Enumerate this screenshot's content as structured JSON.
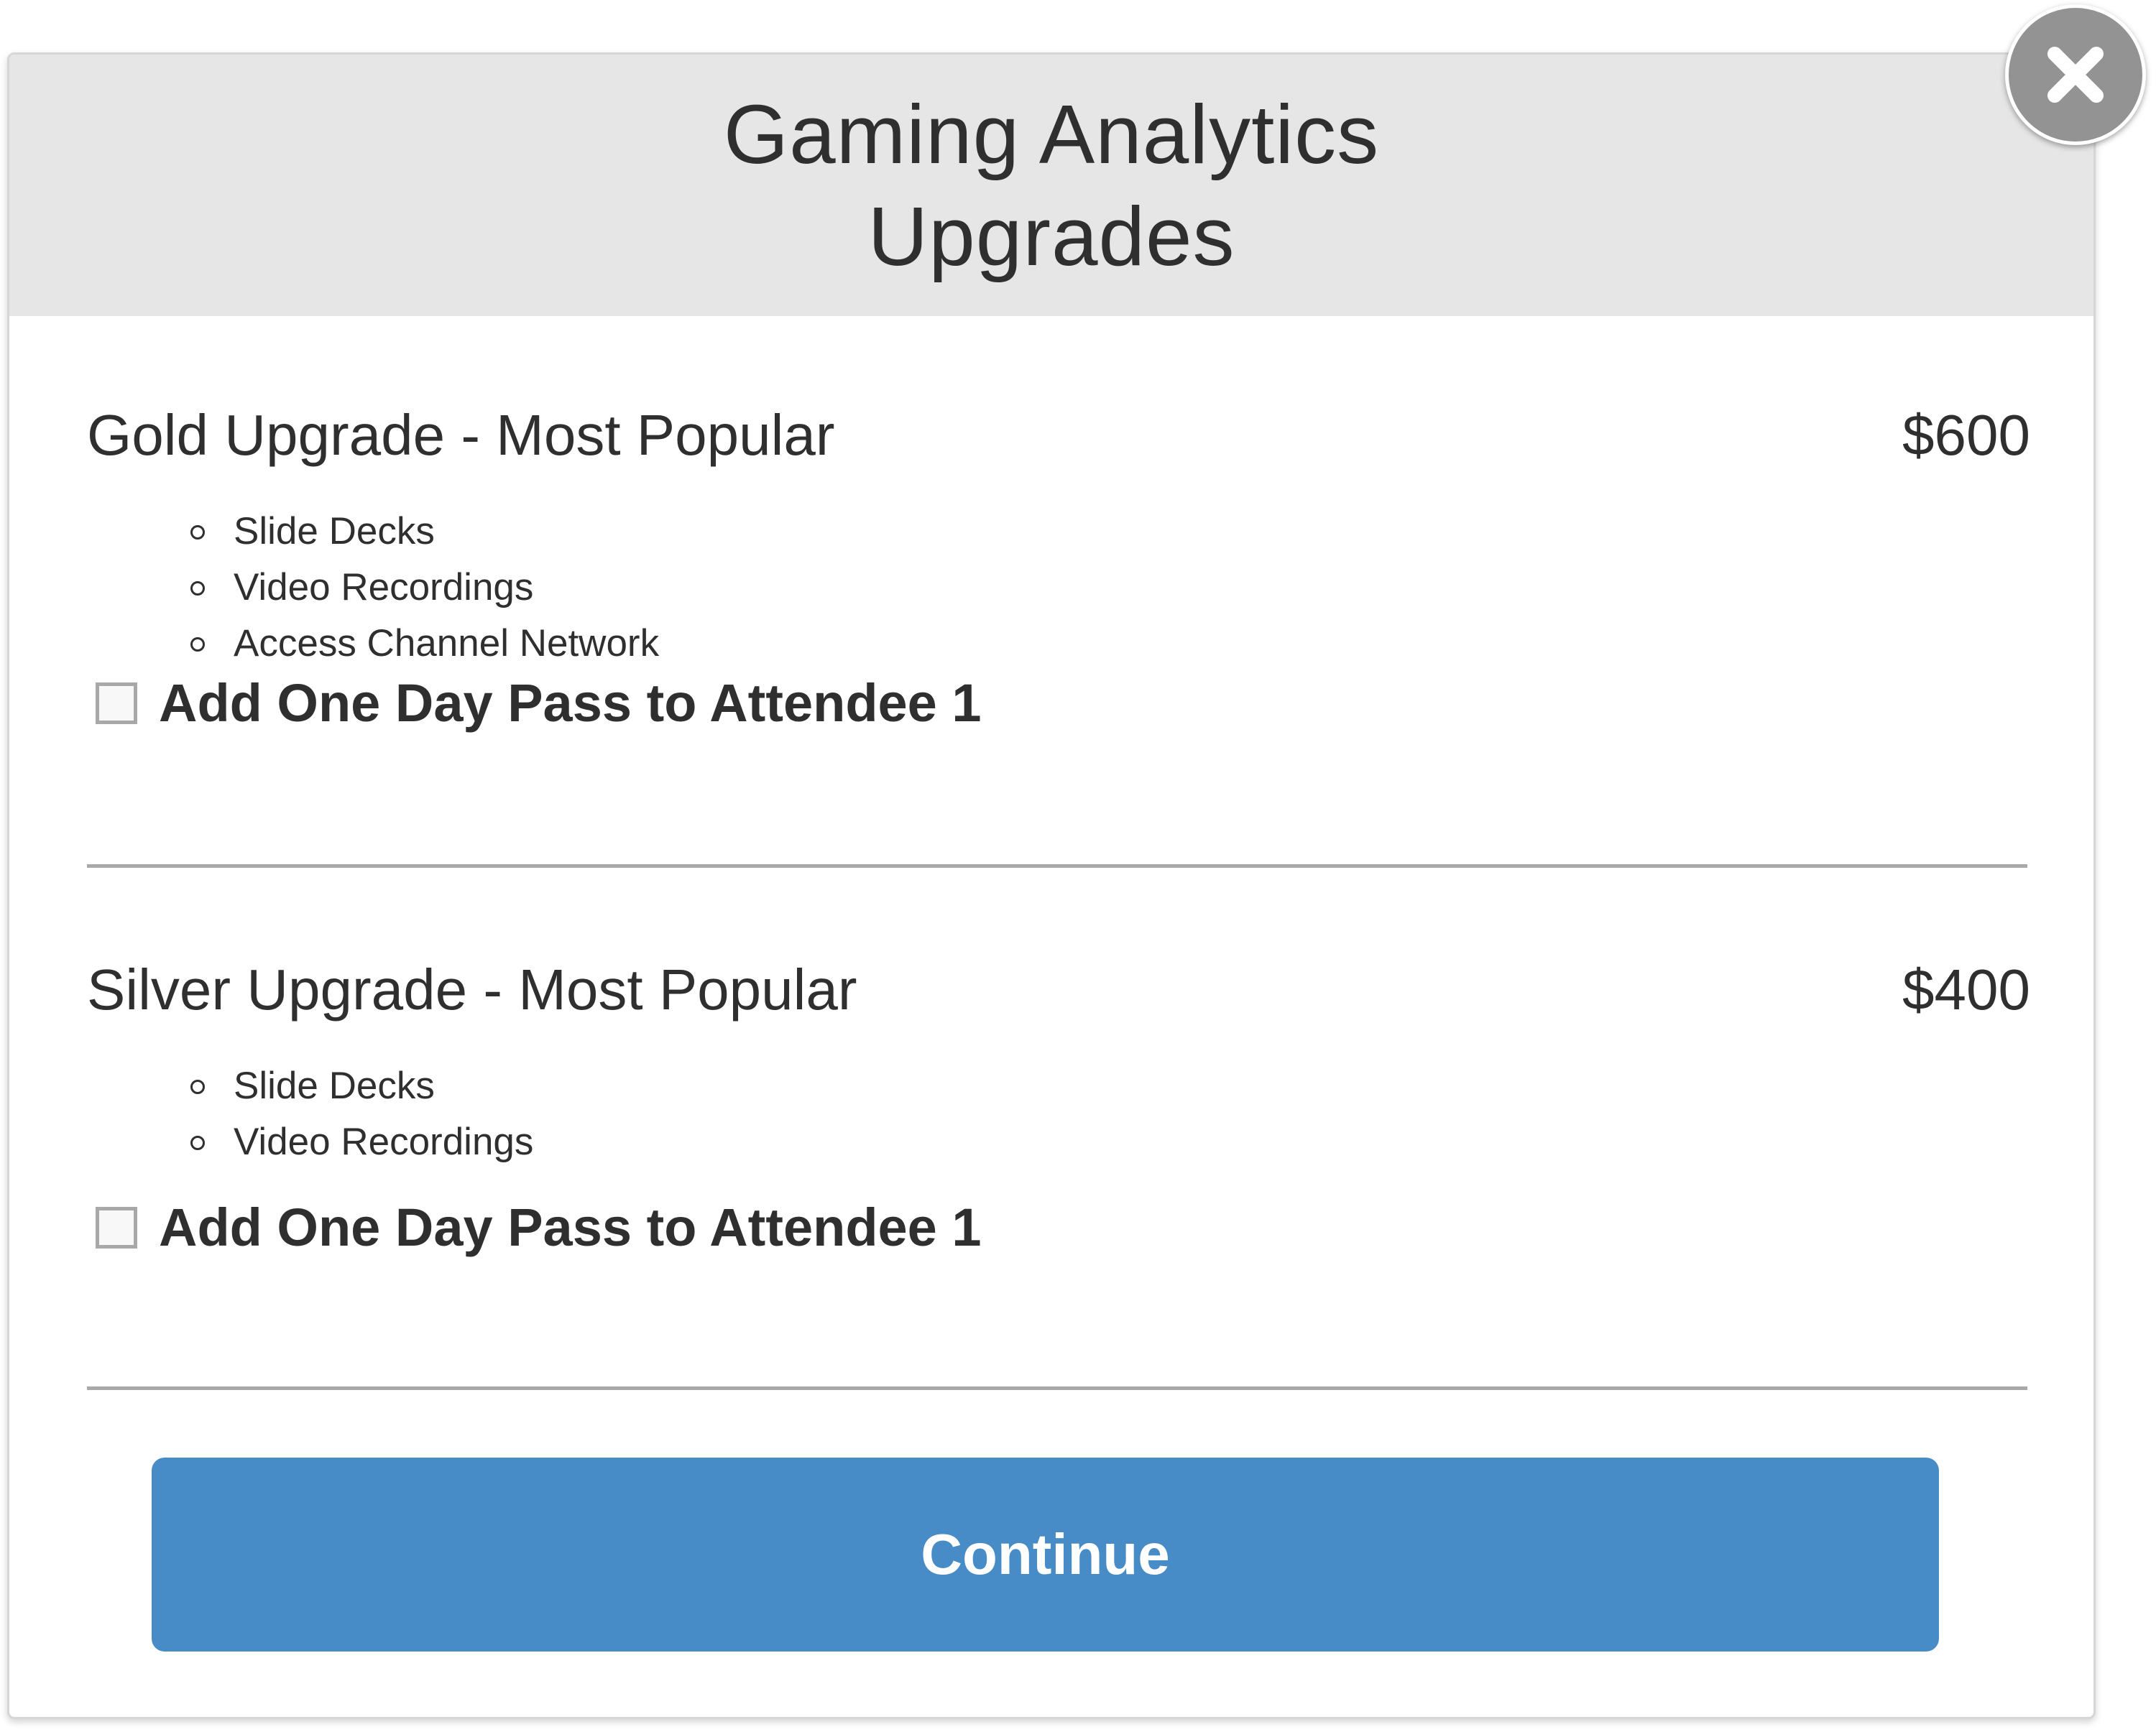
{
  "modal": {
    "title_line1": "Gaming Analytics",
    "title_line2": "Upgrades",
    "close_icon": "close-icon"
  },
  "upgrades": [
    {
      "title": "Gold Upgrade - Most Popular",
      "price": "$600",
      "features": [
        "Slide Decks",
        "Video Recordings",
        "Access Channel Network"
      ],
      "pass_label": "Add One Day Pass to Attendee 1",
      "checked": false
    },
    {
      "title": "Silver Upgrade - Most Popular",
      "price": "$400",
      "features": [
        "Slide Decks",
        "Video Recordings"
      ],
      "pass_label": "Add One Day Pass to Attendee 1",
      "checked": false
    }
  ],
  "actions": {
    "continue_label": "Continue"
  },
  "colors": {
    "header_bg": "#e6e6e6",
    "button_bg": "#478cc7",
    "close_bg": "#939393",
    "text": "#2f2f2f"
  }
}
